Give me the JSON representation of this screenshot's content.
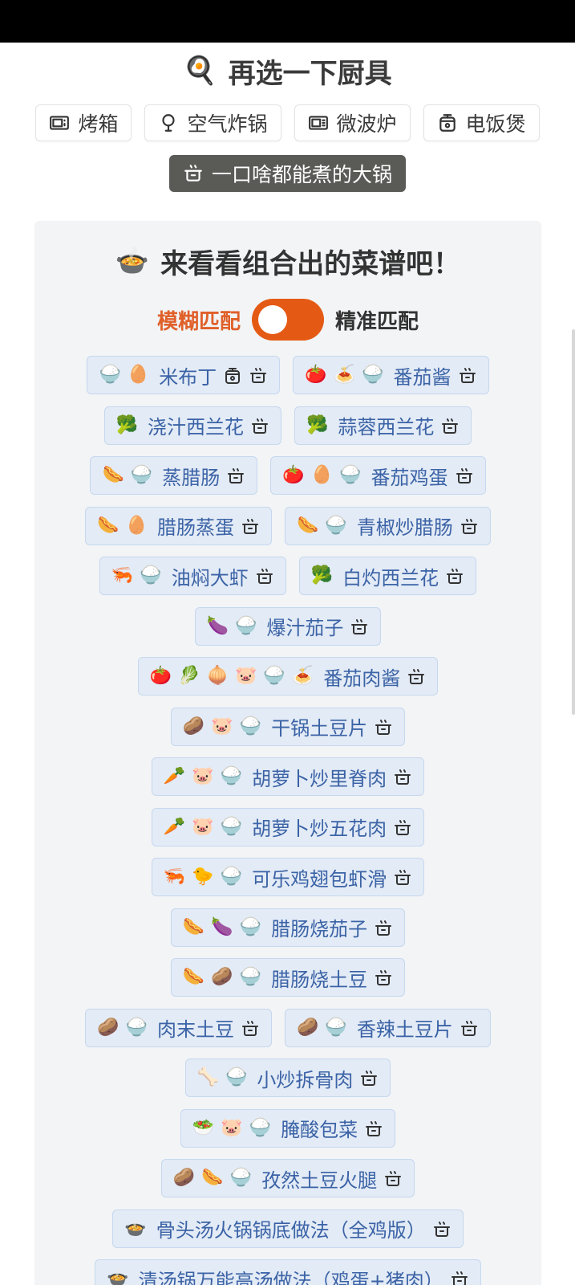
{
  "tools_section": {
    "title": "再选一下厨具",
    "title_emoji": "🍳",
    "tools": [
      {
        "label": "烤箱",
        "icon": "oven-icon",
        "selected": false
      },
      {
        "label": "空气炸锅",
        "icon": "air-fryer-icon",
        "selected": false
      },
      {
        "label": "微波炉",
        "icon": "microwave-icon",
        "selected": false
      },
      {
        "label": "电饭煲",
        "icon": "rice-cooker-icon",
        "selected": false
      },
      {
        "label": "一口啥都能煮的大锅",
        "icon": "pot-icon",
        "selected": true
      }
    ]
  },
  "recipes_section": {
    "title": "来看看组合出的菜谱吧！",
    "title_emoji": "🍲",
    "mode_fuzzy": "模糊匹配",
    "mode_exact": "精准匹配",
    "mode_selected": "模糊匹配",
    "rows": [
      [
        {
          "emojis": [
            "🍚",
            "🥚"
          ],
          "name": "米布丁",
          "tools": [
            "rice-cooker-icon",
            "pot-icon"
          ]
        },
        {
          "emojis": [
            "🍅",
            "🍝",
            "🍚"
          ],
          "name": "番茄酱",
          "tools": [
            "pot-icon"
          ]
        }
      ],
      [
        {
          "emojis": [
            "🥦"
          ],
          "name": "浇汁西兰花",
          "tools": [
            "pot-icon"
          ]
        },
        {
          "emojis": [
            "🥦"
          ],
          "name": "蒜蓉西兰花",
          "tools": [
            "pot-icon"
          ]
        }
      ],
      [
        {
          "emojis": [
            "🌭",
            "🍚"
          ],
          "name": "蒸腊肠",
          "tools": [
            "pot-icon"
          ]
        },
        {
          "emojis": [
            "🍅",
            "🥚",
            "🍚"
          ],
          "name": "番茄鸡蛋",
          "tools": [
            "pot-icon"
          ]
        }
      ],
      [
        {
          "emojis": [
            "🌭",
            "🥚"
          ],
          "name": "腊肠蒸蛋",
          "tools": [
            "pot-icon"
          ]
        },
        {
          "emojis": [
            "🌭",
            "🍚"
          ],
          "name": "青椒炒腊肠",
          "tools": [
            "pot-icon"
          ]
        }
      ],
      [
        {
          "emojis": [
            "🦐",
            "🍚"
          ],
          "name": "油焖大虾",
          "tools": [
            "pot-icon"
          ]
        },
        {
          "emojis": [
            "🥦"
          ],
          "name": "白灼西兰花",
          "tools": [
            "pot-icon"
          ]
        }
      ],
      [
        {
          "emojis": [
            "🍆",
            "🍚"
          ],
          "name": "爆汁茄子",
          "tools": [
            "pot-icon"
          ]
        }
      ],
      [
        {
          "emojis": [
            "🍅",
            "🥬",
            "🧅",
            "🐷",
            "🍚",
            "🍝"
          ],
          "name": "番茄肉酱",
          "tools": [
            "pot-icon"
          ]
        }
      ],
      [
        {
          "emojis": [
            "🥔",
            "🐷",
            "🍚"
          ],
          "name": "干锅土豆片",
          "tools": [
            "pot-icon"
          ]
        }
      ],
      [
        {
          "emojis": [
            "🥕",
            "🐷",
            "🍚"
          ],
          "name": "胡萝卜炒里脊肉",
          "tools": [
            "pot-icon"
          ]
        }
      ],
      [
        {
          "emojis": [
            "🥕",
            "🐷",
            "🍚"
          ],
          "name": "胡萝卜炒五花肉",
          "tools": [
            "pot-icon"
          ]
        }
      ],
      [
        {
          "emojis": [
            "🦐",
            "🐤",
            "🍚"
          ],
          "name": "可乐鸡翅包虾滑",
          "tools": [
            "pot-icon"
          ]
        }
      ],
      [
        {
          "emojis": [
            "🌭",
            "🍆",
            "🍚"
          ],
          "name": "腊肠烧茄子",
          "tools": [
            "pot-icon"
          ]
        }
      ],
      [
        {
          "emojis": [
            "🌭",
            "🥔",
            "🍚"
          ],
          "name": "腊肠烧土豆",
          "tools": [
            "pot-icon"
          ]
        }
      ],
      [
        {
          "emojis": [
            "🥔",
            "🍚"
          ],
          "name": "肉末土豆",
          "tools": [
            "pot-icon"
          ]
        },
        {
          "emojis": [
            "🥔",
            "🍚"
          ],
          "name": "香辣土豆片",
          "tools": [
            "pot-icon"
          ]
        }
      ],
      [
        {
          "emojis": [
            "🦴",
            "🍚"
          ],
          "name": "小炒拆骨肉",
          "tools": [
            "pot-icon"
          ]
        }
      ],
      [
        {
          "emojis": [
            "🥗",
            "🐷",
            "🍚"
          ],
          "name": "腌酸包菜",
          "tools": [
            "pot-icon"
          ]
        }
      ],
      [
        {
          "emojis": [
            "🥔",
            "🌭",
            "🍚"
          ],
          "name": "孜然土豆火腿",
          "tools": [
            "pot-icon"
          ]
        }
      ],
      [
        {
          "emojis": [
            "🍲"
          ],
          "name": "骨头汤火锅锅底做法（全鸡版）",
          "tools": [
            "pot-icon"
          ]
        }
      ],
      [
        {
          "emojis": [
            "🍲"
          ],
          "name": "清汤锅万能高汤做法（鸡蛋+猪肉）",
          "tools": [
            "pot-icon"
          ]
        }
      ]
    ]
  }
}
